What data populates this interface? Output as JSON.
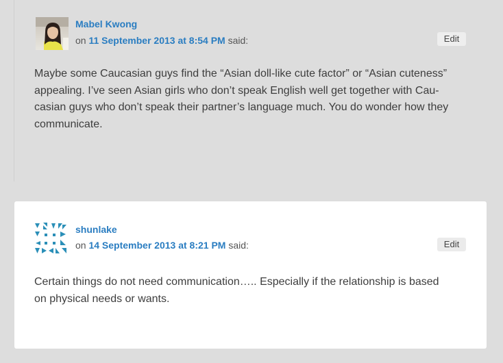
{
  "comments": [
    {
      "author": "Mabel Kwong",
      "on": "on",
      "date": "11 September 2013 at 8:54 PM",
      "said": "said:",
      "edit_label": "Edit",
      "text": "Maybe some Caucasian guys find the “Asian doll-like cute factor” or “Asian cuteness” appealing. I’ve seen Asian girls who don’t speak English well get together with Cau-casian guys who don’t speak their partner’s language much. You do wonder how they communicate.",
      "text_lines": [
        "Maybe some Caucasian guys find the “Asian doll-like cute factor” or “Asian cuteness”",
        "appealing. I’ve seen Asian girls who don’t speak English well get together with Cau-",
        "casian guys who don’t speak their partner’s language much. You do wonder how they",
        "communicate."
      ]
    },
    {
      "author": "shunlake",
      "on": "on",
      "date": "14 September 2013 at 8:21 PM",
      "said": "said:",
      "edit_label": "Edit",
      "text": "Certain things do not need communication….. Especially if the relationship is based on physical needs or wants.",
      "text_lines": [
        "Certain things do not need communication….. Especially if the relationship is based",
        "on physical needs or wants."
      ]
    }
  ],
  "colors": {
    "page_background": "#dddddd",
    "card_background": "#ffffff",
    "link": "#2a7dc1",
    "text": "#3d3d3d",
    "identicon": "#2b8fb8"
  },
  "icons": {
    "avatar_1": "user-photo-avatar",
    "avatar_2": "identicon-avatar"
  }
}
